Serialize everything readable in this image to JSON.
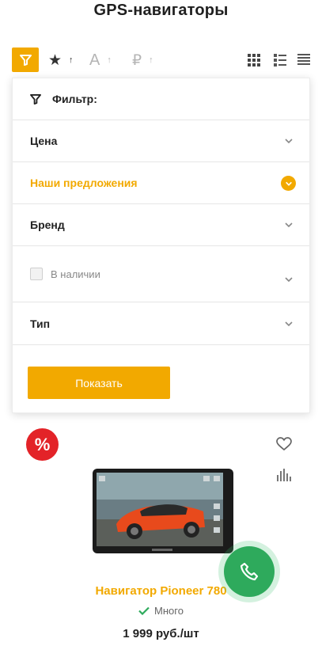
{
  "page": {
    "title": "GPS-навигаторы"
  },
  "toolbar": {
    "filter_icon": "filter-funnel-icon",
    "sort_options": [
      {
        "symbol": "★",
        "arrow": "↑",
        "icon": "star-icon"
      },
      {
        "symbol": "A",
        "arrow": "↑",
        "icon": "alpha-sort-icon"
      },
      {
        "symbol": "₽",
        "arrow": "↑",
        "icon": "ruble-sort-icon"
      }
    ],
    "views": [
      "grid-view-icon",
      "list-view-icon",
      "table-view-icon"
    ]
  },
  "filter": {
    "header": "Фильтр:",
    "sections": {
      "price": "Цена",
      "offers": "Наши предложения",
      "brand": "Бренд",
      "in_stock": "В наличии",
      "type": "Тип"
    },
    "submit": "Показать"
  },
  "product": {
    "badge": "%",
    "name": "Навигатор Pioneer 780",
    "availability": "Много",
    "price": "1 999 руб./шт"
  },
  "colors": {
    "accent": "#f2a900",
    "discount": "#e32328",
    "call": "#2eaa5c",
    "in_stock": "#2eaa5c"
  }
}
